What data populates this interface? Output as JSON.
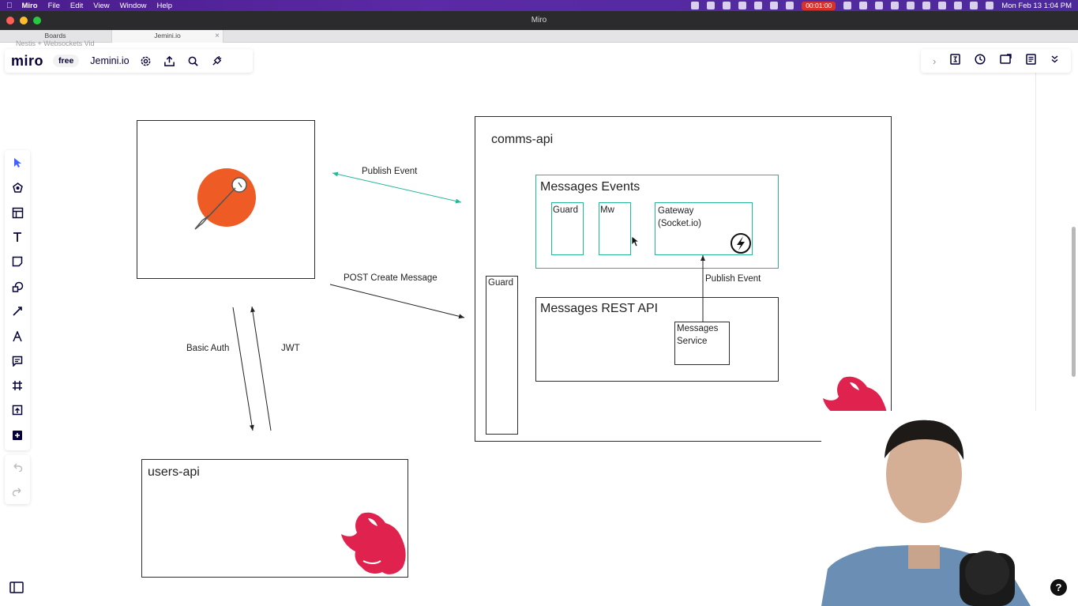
{
  "menubar": {
    "app": "Miro",
    "items": [
      "File",
      "Edit",
      "View",
      "Window",
      "Help"
    ],
    "recording_time": "00:01:00",
    "datetime": "Mon Feb 13  1:04 PM"
  },
  "window": {
    "title": "Miro"
  },
  "tabs": [
    {
      "label": "Boards"
    },
    {
      "label": "Jemini.io",
      "active": true
    }
  ],
  "breadcrumb": "Nestis + Websockets Vid",
  "topbar": {
    "logo": "miro",
    "plan": "free",
    "board_name": "Jemini.io",
    "icons": [
      "settings-icon",
      "share-upload-icon",
      "search-icon",
      "integrations-icon"
    ]
  },
  "topright_icons": [
    "collapse-chevron-icon",
    "timer-count-icon",
    "clock-icon",
    "present-icon",
    "notes-icon",
    "more-chevron-icon"
  ],
  "left_tools": [
    "select-icon",
    "templates-icon",
    "frame-grid-icon",
    "text-icon",
    "sticky-note-icon",
    "shapes-icon",
    "pen-line-icon",
    "draw-icon",
    "comment-icon",
    "frame-icon",
    "upload-icon",
    "add-more-icon"
  ],
  "diagram": {
    "comms_api": "comms-api",
    "messages_events": "Messages Events",
    "guard_inner": "Guard",
    "mw": "Mw",
    "gateway_line1": "Gateway",
    "gateway_line2": "(Socket.io)",
    "guard_outer": "Guard",
    "messages_rest_api": "Messages REST API",
    "messages_service_line1": "Messages",
    "messages_service_line2": "Service",
    "publish_event_inner": "Publish Event",
    "publish_event_outer": "Publish Event",
    "post_create_message": "POST Create Message",
    "basic_auth": "Basic Auth",
    "jwt": "JWT",
    "users_api": "users-api"
  },
  "colors": {
    "accent_green": "#24b89a",
    "nest_red": "#e0234e",
    "postman_orange": "#ef5b25",
    "selected_tool": "#4262ff"
  },
  "help": "?"
}
